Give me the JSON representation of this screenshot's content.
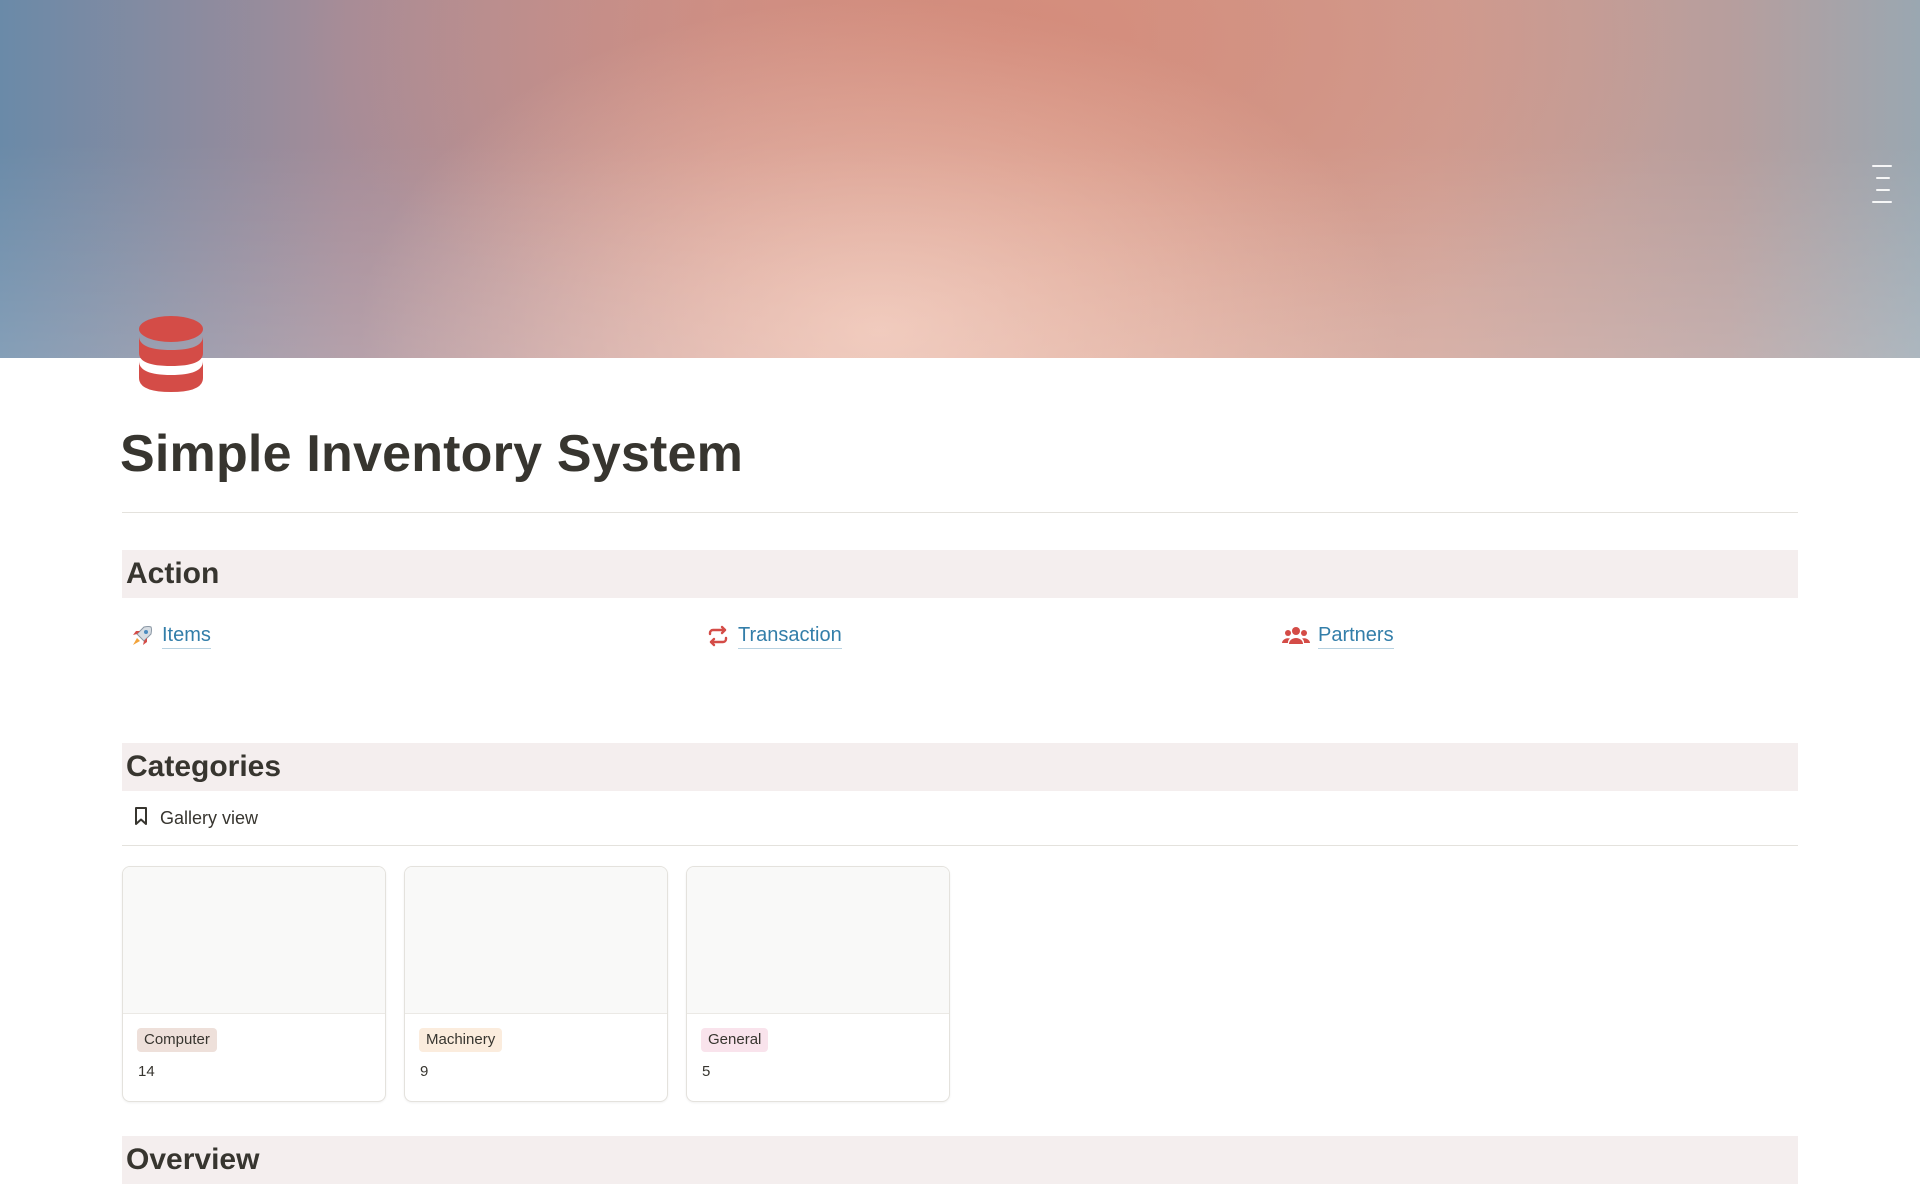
{
  "page": {
    "title": "Simple Inventory System",
    "icon": "database-icon"
  },
  "colors": {
    "accent_link": "#337ea9",
    "section_bg": "#f4eeee",
    "icon_red": "#d44c47",
    "text": "#37352f"
  },
  "action": {
    "heading": "Action",
    "links": [
      {
        "label": "Items",
        "icon": "rocket-icon"
      },
      {
        "label": "Transaction",
        "icon": "repeat-icon"
      },
      {
        "label": "Partners",
        "icon": "people-icon"
      }
    ]
  },
  "categories": {
    "heading": "Categories",
    "view_label": "Gallery view",
    "view_icon": "bookmark-icon",
    "cards": [
      {
        "tag": "Computer",
        "tag_color": "#eee0da",
        "count": "14"
      },
      {
        "tag": "Machinery",
        "tag_color": "#fbecdd",
        "count": "9"
      },
      {
        "tag": "General",
        "tag_color": "#f9e3ec",
        "count": "5"
      }
    ]
  },
  "overview": {
    "heading": "Overview"
  }
}
